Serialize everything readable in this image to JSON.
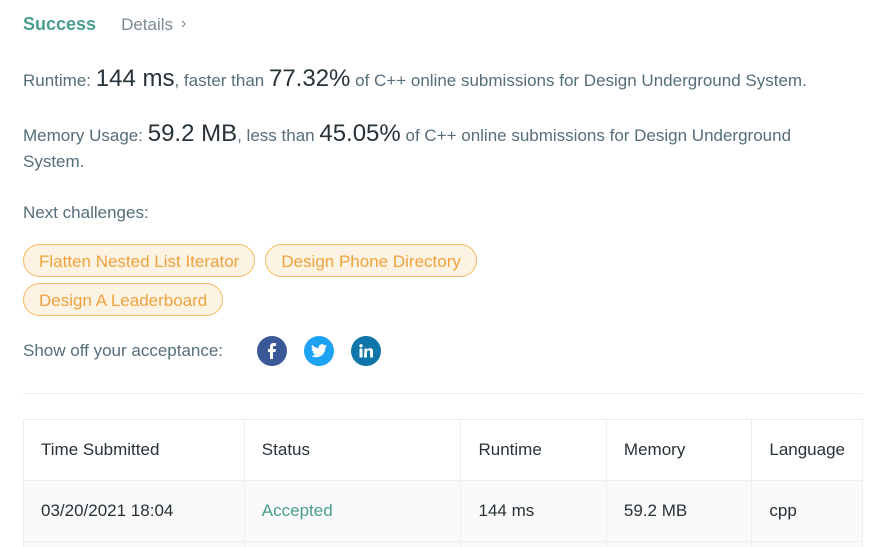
{
  "header": {
    "success_tab": "Success",
    "details_tab": "Details"
  },
  "runtime": {
    "label": "Runtime:",
    "value": "144 ms",
    "faster_text": ", faster than",
    "percent": "77.32%",
    "suffix": "of C++ online submissions for Design Underground System."
  },
  "memory": {
    "label": "Memory Usage:",
    "value": "59.2 MB",
    "less_text": ", less than",
    "percent": "45.05%",
    "suffix": "of C++ online submissions for Design Underground System."
  },
  "next_challenges": {
    "label": "Next challenges:",
    "items": [
      "Flatten Nested List Iterator",
      "Design Phone Directory",
      "Design A Leaderboard"
    ]
  },
  "share": {
    "label": "Show off your acceptance:",
    "icons": [
      "facebook-icon",
      "twitter-icon",
      "linkedin-icon"
    ]
  },
  "table": {
    "headers": [
      "Time Submitted",
      "Status",
      "Runtime",
      "Memory",
      "Language"
    ],
    "rows": [
      {
        "time": "03/20/2021 18:04",
        "status": "Accepted",
        "runtime": "144 ms",
        "memory": "59.2 MB",
        "language": "cpp"
      }
    ]
  },
  "colors": {
    "accent": "#4a9d8f",
    "chip_text": "#f0a23e",
    "chip_bg": "#fdf3e3",
    "facebook": "#3b5998",
    "twitter": "#1da1f2",
    "linkedin": "#0e76a8"
  }
}
